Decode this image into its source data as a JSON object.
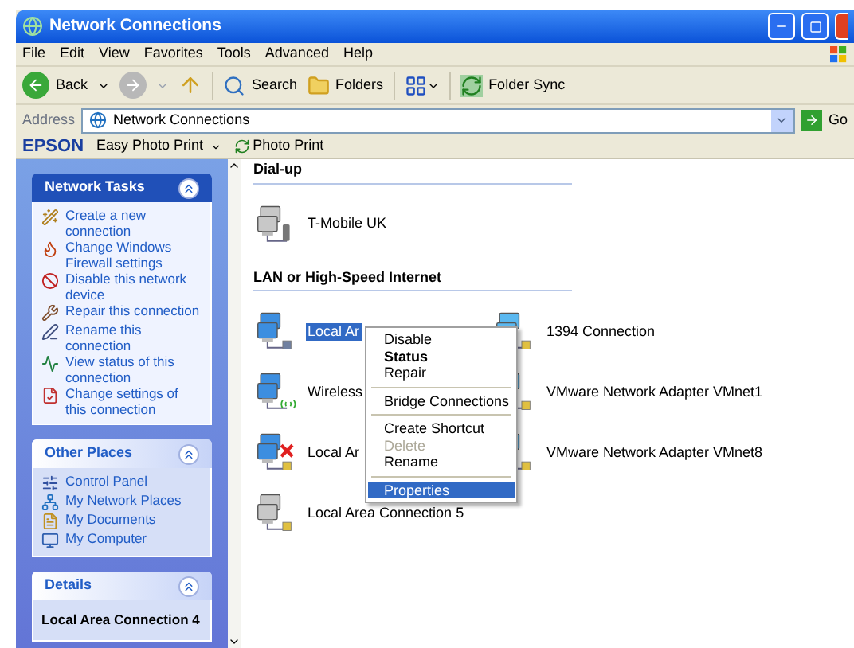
{
  "window": {
    "title": "Network Connections"
  },
  "menu": [
    "File",
    "Edit",
    "View",
    "Favorites",
    "Tools",
    "Advanced",
    "Help"
  ],
  "toolbar": {
    "back": "Back",
    "search": "Search",
    "folders": "Folders",
    "sync": "Folder Sync"
  },
  "address": {
    "label": "Address",
    "value": "Network Connections",
    "go": "Go"
  },
  "epson_bar": {
    "logo": "EPSON",
    "easy_print": "Easy Photo Print",
    "photo_print": "Photo Print"
  },
  "sidebar": {
    "panels": [
      {
        "title": "Network Tasks",
        "kind": "tasks",
        "items": [
          "Create a new connection",
          "Change Windows Firewall settings",
          "Disable this network device",
          "Repair this connection",
          "Rename this connection",
          "View status of this connection",
          "Change settings of this connection"
        ]
      },
      {
        "title": "Other Places",
        "kind": "places",
        "items": [
          "Control Panel",
          "My Network Places",
          "My Documents",
          "My Computer"
        ]
      },
      {
        "title": "Details",
        "kind": "details",
        "items": [
          "Local Area Connection 4"
        ]
      }
    ]
  },
  "sections": [
    {
      "title": "Dial-up",
      "connections": [
        {
          "name": "T-Mobile UK",
          "kind": "dialup",
          "selected": false
        }
      ]
    },
    {
      "title": "LAN or High-Speed Internet",
      "connections": [
        {
          "name": "Local Ar",
          "kind": "lan",
          "selected": true
        },
        {
          "name": "1394 Connection",
          "kind": "lan-alt",
          "selected": false
        },
        {
          "name": "Wireless",
          "kind": "wireless",
          "selected": false
        },
        {
          "name": "VMware Network Adapter VMnet1",
          "kind": "lan-alt",
          "selected": false
        },
        {
          "name": "Local Ar",
          "kind": "disconnected",
          "selected": false
        },
        {
          "name": "VMware Network Adapter VMnet8",
          "kind": "lan-alt",
          "selected": false
        },
        {
          "name": "Local Area Connection 5",
          "kind": "disabled",
          "selected": false
        }
      ]
    }
  ],
  "context_menu": [
    {
      "kind": "item",
      "label": "Disable",
      "default": false,
      "disabled": false,
      "selected": false
    },
    {
      "kind": "item",
      "label": "Status",
      "default": true,
      "disabled": false,
      "selected": false
    },
    {
      "kind": "item",
      "label": "Repair",
      "default": false,
      "disabled": false,
      "selected": false
    },
    {
      "kind": "separator"
    },
    {
      "kind": "item",
      "label": "Bridge Connections",
      "default": false,
      "disabled": false,
      "selected": false
    },
    {
      "kind": "separator"
    },
    {
      "kind": "item",
      "label": "Create Shortcut",
      "default": false,
      "disabled": false,
      "selected": false
    },
    {
      "kind": "item",
      "label": "Delete",
      "default": false,
      "disabled": true,
      "selected": false
    },
    {
      "kind": "item",
      "label": "Rename",
      "default": false,
      "disabled": false,
      "selected": false
    },
    {
      "kind": "separator"
    },
    {
      "kind": "item",
      "label": "Properties",
      "default": false,
      "disabled": false,
      "selected": true
    }
  ]
}
